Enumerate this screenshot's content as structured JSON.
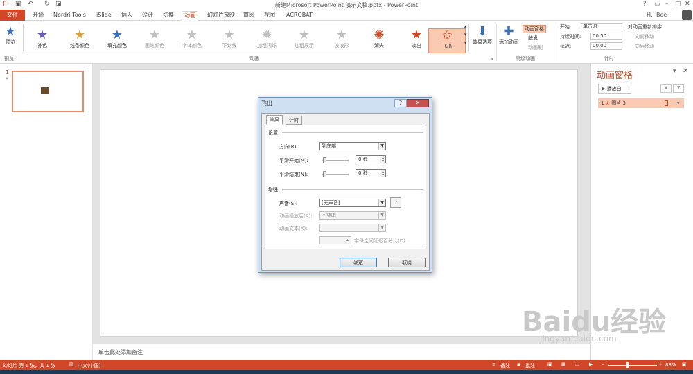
{
  "window": {
    "title": "新建Microsoft PowerPoint 演示文稿.pptx - PowerPoint",
    "user": "H、Bee",
    "help": "?"
  },
  "tabs": [
    {
      "label": "文件"
    },
    {
      "label": "开始"
    },
    {
      "label": "Nordri Tools"
    },
    {
      "label": "iSlide"
    },
    {
      "label": "插入"
    },
    {
      "label": "设计"
    },
    {
      "label": "切换"
    },
    {
      "label": "动画"
    },
    {
      "label": "幻灯片放映"
    },
    {
      "label": "审阅"
    },
    {
      "label": "视图"
    },
    {
      "label": "ACROBAT"
    }
  ],
  "ribbon": {
    "preview_label": "预览",
    "preview_group": "预览",
    "animation_group": "动画",
    "advanced_group": "高级动画",
    "timing_group": "计时",
    "effects": [
      {
        "label": "补色",
        "color": "#6b5bb8",
        "dim": false
      },
      {
        "label": "线条颜色",
        "color": "#d9a441",
        "dim": false
      },
      {
        "label": "填充颜色",
        "color": "#e5b441",
        "dim": false
      },
      {
        "label": "画笔颜色",
        "color": "#c0c0c0",
        "dim": true
      },
      {
        "label": "字体颜色",
        "color": "#c0c0c0",
        "dim": true
      },
      {
        "label": "下划线",
        "color": "#c0c0c0",
        "dim": true
      },
      {
        "label": "加粗闪烁",
        "color": "#c0c0c0",
        "dim": true
      },
      {
        "label": "加粗展示",
        "color": "#c0c0c0",
        "dim": true
      },
      {
        "label": "波浪形",
        "color": "#c0c0c0",
        "dim": true
      },
      {
        "label": "消失",
        "color": "#d24726",
        "dim": false
      },
      {
        "label": "淡出",
        "color": "#d24726",
        "dim": false
      },
      {
        "label": "飞出",
        "color": "#d24726",
        "dim": false
      }
    ],
    "effect_options": "效果选项",
    "add_animation": "添加动画",
    "anim_pane_btn": "动画窗格",
    "trigger": "触发",
    "anim_painter": "动画刷",
    "start_label": "开始:",
    "start_value": "单击时",
    "duration_label": "持续时间:",
    "duration_value": "00.50",
    "delay_label": "延迟:",
    "delay_value": "00.00",
    "reorder": "对动画重新排序",
    "move_earlier": "向前移动",
    "move_later": "向后移动"
  },
  "thumbs": {
    "number": "1",
    "star": "*"
  },
  "notes_placeholder": "单击此处添加备注",
  "anim_pane": {
    "title": "动画窗格",
    "play_from": "播放自",
    "item_index": "1",
    "item_name": "图片 3"
  },
  "dialog": {
    "title": "飞出",
    "tab_effect": "效果",
    "tab_timing": "计时",
    "section_settings": "设置",
    "direction_label": "方向(R):",
    "direction_value": "到底部",
    "smooth_start_label": "平滑开始(M):",
    "smooth_start_value": "0 秒",
    "smooth_end_label": "平滑结束(N):",
    "smooth_end_value": "0 秒",
    "section_enhance": "增强",
    "sound_label": "声音(S):",
    "sound_value": "[无声音]",
    "after_anim_label": "动画播放后(A):",
    "after_anim_value": "不变暗",
    "anim_text_label": "动画文本(X):",
    "anim_text_value": "",
    "delay_between": "字母之间延迟百分比(D)",
    "ok": "确定",
    "cancel": "取消",
    "help": "?",
    "close": "✕"
  },
  "status": {
    "slide_info": "幻灯片 第 1 张，共 1 张",
    "language": "中文(中国)",
    "notes": "备注",
    "comments": "批注",
    "zoom": "83%"
  },
  "watermark": {
    "brand": "Baidu经验",
    "url": "jingyan.baidu.com"
  },
  "notes_page_field": "0"
}
